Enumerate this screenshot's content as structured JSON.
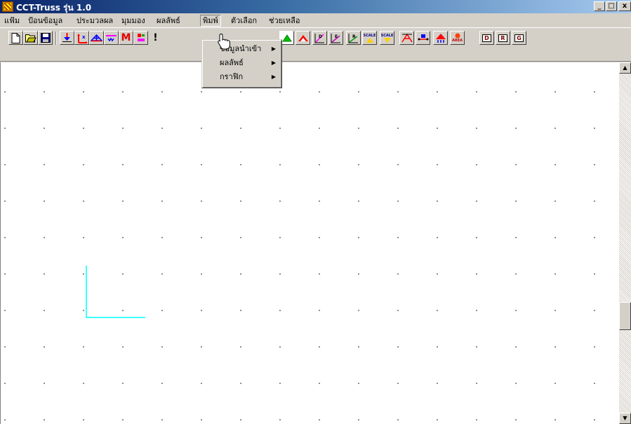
{
  "window": {
    "title": "CCT-Truss  รุ่น 1.0",
    "buttons": [
      "_",
      "□",
      "x"
    ]
  },
  "menubar": {
    "items": [
      {
        "label": "แฟ้ม"
      },
      {
        "label": "ป้อนข้อมูล"
      },
      {
        "label": "ประมวลผล"
      },
      {
        "label": "มุมมอง"
      },
      {
        "label": "ผลลัพธ์"
      },
      {
        "label": "พิมพ์"
      },
      {
        "label": "ตัวเลือก"
      },
      {
        "label": "ช่วยเหลือ"
      }
    ],
    "open_menu": "พิมพ์"
  },
  "print_menu": {
    "items": [
      {
        "label": "ข้อมูลนำเข้า",
        "submenu": true
      },
      {
        "label": "ผลลัพธ์",
        "submenu": true
      },
      {
        "label": "กราฟิก",
        "submenu": true
      }
    ]
  },
  "toolbar": {
    "buttons": [
      {
        "icon": "new-file-icon"
      },
      {
        "icon": "open-folder-icon"
      },
      {
        "icon": "save-icon"
      },
      {
        "icon": "support-icon"
      },
      {
        "icon": "load-xy-icon"
      },
      {
        "icon": "truss-member-icon"
      },
      {
        "icon": "spring-icon"
      },
      {
        "icon": "moment-icon",
        "text": "M"
      },
      {
        "icon": "section-icon"
      },
      {
        "icon": "run-icon",
        "text": "!"
      },
      {
        "icon": "deformed-shape-icon"
      },
      {
        "icon": "truss-shape-icon"
      },
      {
        "icon": "diagram-d-icon",
        "text": "D"
      },
      {
        "icon": "diagram-e-icon",
        "text": "E"
      },
      {
        "icon": "diagram-r-icon",
        "text": "R"
      },
      {
        "icon": "scale-up-icon",
        "text": "SCALE"
      },
      {
        "icon": "scale-down-icon",
        "text": "SCALE"
      },
      {
        "icon": "frame-icon"
      },
      {
        "icon": "node-label-icon"
      },
      {
        "icon": "reaction-icon"
      },
      {
        "icon": "area-icon",
        "text": "AREA"
      },
      {
        "icon": "print-d-icon",
        "text": "D"
      },
      {
        "icon": "print-r-icon",
        "text": "R"
      },
      {
        "icon": "print-g-icon",
        "text": "G"
      }
    ]
  },
  "colors": {
    "titlebar_start": "#0a246a",
    "titlebar_end": "#a6caf0",
    "chrome": "#d4d0c8",
    "drawing_line": "#00ffff",
    "canvas": "#ffffff"
  }
}
